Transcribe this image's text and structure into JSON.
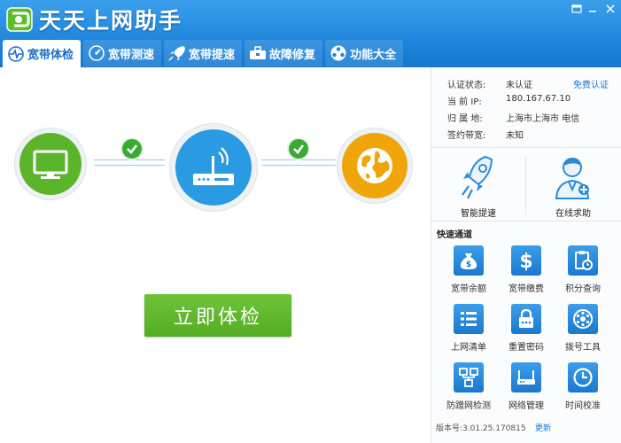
{
  "app": {
    "title": "天天上网助手"
  },
  "colors": {
    "header_blue": "#2089dc",
    "green": "#5ab52a",
    "blue_node": "#2a9ae3",
    "orange_node": "#f0a50a",
    "link_blue": "#1a73d0"
  },
  "tabs": [
    {
      "label": "宽带体检",
      "icon": "health-check-icon",
      "active": true
    },
    {
      "label": "宽带测速",
      "icon": "speedometer-icon"
    },
    {
      "label": "宽带提速",
      "icon": "rocket-icon"
    },
    {
      "label": "故障修复",
      "icon": "toolbox-icon"
    },
    {
      "label": "功能大全",
      "icon": "apps-icon"
    }
  ],
  "main": {
    "start_label": "立即体检"
  },
  "info": {
    "rows": [
      {
        "label": "认证状态:",
        "value": "未认证"
      },
      {
        "label": "当 前 IP:",
        "value": "180.167.67.10"
      },
      {
        "label": "归 属 地:",
        "value": "上海市上海市 电信"
      },
      {
        "label": "签约带宽:",
        "value": "未知"
      }
    ],
    "free_auth_label": "免费认证"
  },
  "big_buttons": [
    {
      "label": "智能提速",
      "icon": "rocket-icon"
    },
    {
      "label": "在线求助",
      "icon": "support-agent-icon"
    }
  ],
  "quick": {
    "title": "快速通道",
    "items": [
      {
        "label": "宽带余额",
        "icon": "money-bag-icon"
      },
      {
        "label": "宽带缴费",
        "icon": "dollar-icon"
      },
      {
        "label": "积分查询",
        "icon": "clipboard-clock-icon"
      },
      {
        "label": "上网清单",
        "icon": "list-icon"
      },
      {
        "label": "重置密码",
        "icon": "lock-icon"
      },
      {
        "label": "拨号工具",
        "icon": "rotary-phone-icon"
      },
      {
        "label": "防蹭网检测",
        "icon": "network-icon"
      },
      {
        "label": "网络管理",
        "icon": "router-icon"
      },
      {
        "label": "时间校准",
        "icon": "clock-icon"
      }
    ]
  },
  "footer": {
    "version": "版本号:3.01.25.170815",
    "update_label": "更新"
  }
}
